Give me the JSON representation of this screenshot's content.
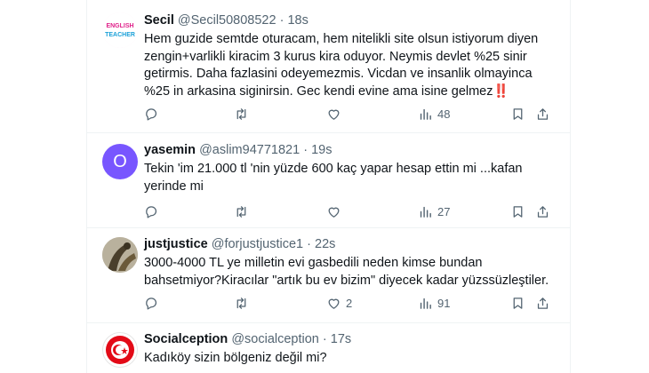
{
  "tweets": [
    {
      "name": "Secil",
      "handle": "@Secil50808522",
      "separator": "·",
      "time": "18s",
      "avatar_text": [
        "ENGLISH",
        "TEACHER"
      ],
      "text": "Hem guzide semtde oturacam, hem nitelikli site olsun istiyorum diyen zengin+varlikli kiracim 3 kurus kira oduyor. Neymis devlet %25 sinir getirmis. Daha fazlasini odeyemezmis. Vicdan ve insanlik olmayinca %25 in arkasina siginirsin. Gec kendi evine ama isine gelmez",
      "emoji": "‼️",
      "replies": "",
      "retweets": "",
      "likes": "",
      "views": "48"
    },
    {
      "name": "yasemin",
      "handle": "@aslim94771821",
      "separator": "·",
      "time": "19s",
      "avatar_letter": "O",
      "avatar_color": "#7856ff",
      "text": "Tekin 'im 21.000 tl 'nin yüzde 600 kaç yapar hesap ettin mi ...kafan yerinde mi",
      "replies": "",
      "retweets": "",
      "likes": "",
      "views": "27"
    },
    {
      "name": "justjustice",
      "handle": "@forjustjustice1",
      "separator": "·",
      "time": "22s",
      "text": "3000-4000 TL ye milletin evi gasbedili neden kimse bundan bahsetmiyor?Kiracılar \"artık bu ev bizim\" diyecek kadar yüzssüzleştiler.",
      "replies": "",
      "retweets": "",
      "likes": "2",
      "views": "91"
    },
    {
      "name": "Socialception",
      "handle": "@socialception",
      "separator": "·",
      "time": "17s",
      "text": "Kadıköy sizin bölgeniz değil mi?"
    }
  ],
  "icons": {
    "reply": "reply-icon",
    "retweet": "retweet-icon",
    "like": "heart-icon",
    "views": "views-icon",
    "bookmark": "bookmark-icon",
    "share": "share-icon"
  },
  "colors": {
    "secondary_text": "#536471",
    "divider": "#eff3f4",
    "alert_emoji": "#f4212e"
  }
}
